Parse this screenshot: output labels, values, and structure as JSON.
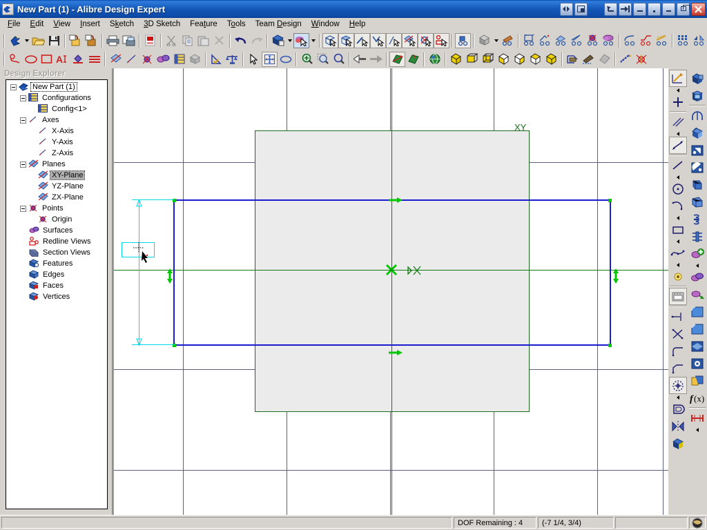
{
  "window": {
    "title": "New Part (1) - Alibre Design Expert",
    "app_icon": "alibre-logo-icon",
    "buttons": [
      {
        "name": "mdi-restore-left-button",
        "glyph": "◀▶"
      },
      {
        "name": "mdi-minimize-left-button",
        "glyph": "▣"
      },
      {
        "name": "undo-window-button",
        "glyph": "↰"
      },
      {
        "name": "pin-window-button",
        "glyph": "⇥"
      },
      {
        "name": "minimize-button",
        "glyph": "–"
      },
      {
        "name": "dot-button",
        "glyph": "·"
      },
      {
        "name": "minimize2-button",
        "glyph": "–"
      },
      {
        "name": "restore-button",
        "glyph": "❐"
      },
      {
        "name": "close-button",
        "glyph": "✕"
      }
    ]
  },
  "menubar": {
    "items": [
      {
        "label": "File",
        "accel": "F"
      },
      {
        "label": "Edit",
        "accel": "E"
      },
      {
        "label": "View",
        "accel": "V"
      },
      {
        "label": "Insert",
        "accel": "I"
      },
      {
        "label": "Sketch",
        "accel": "k"
      },
      {
        "label": "3D Sketch",
        "accel": "3"
      },
      {
        "label": "Feature",
        "accel": "t"
      },
      {
        "label": "Tools",
        "accel": "o"
      },
      {
        "label": "Team Design",
        "accel": "D"
      },
      {
        "label": "Window",
        "accel": "W"
      },
      {
        "label": "Help",
        "accel": "H"
      }
    ]
  },
  "toolbar_main": {
    "groups": [
      [
        "new-part-icon",
        "new-part-dropdown-icon",
        "open-icon",
        "save-icon"
      ],
      [
        "check-out-icon",
        "check-in-icon"
      ],
      [
        "print-icon",
        "print-preview-icon"
      ],
      [
        "export-pdf-icon"
      ],
      [
        "cut-icon",
        "copy-icon",
        "paste-icon",
        "delete-icon"
      ],
      [
        "undo-icon",
        "redo-icon"
      ],
      [
        "view-orientation-icon",
        "view-orientation-dropdown-icon",
        "select-mode-icon",
        "select-mode-dropdown-icon"
      ],
      [
        "select-part-icon",
        "select-face-icon",
        "select-edge-icon",
        "select-vertex-icon",
        "select-point-icon",
        "select-plane-icon",
        "select-axis-icon",
        "select-sketch-icon"
      ],
      [
        "assembly-icon"
      ],
      [
        "render-shaded-icon",
        "render-dropdown-icon",
        "color-properties-icon"
      ],
      [
        "extrude-boss-icon",
        "revolve-boss-icon",
        "sweep-boss-icon",
        "loft-boss-icon",
        "extrude-cut-icon",
        "revolve-cut-icon"
      ],
      [
        "fillet-icon",
        "chamfer-icon",
        "shell-icon"
      ],
      [
        "pattern-icon",
        "mirror-icon",
        "draft-icon"
      ]
    ]
  },
  "toolbar_sketch": {
    "groups": [
      [
        "sketch-arc-icon",
        "sketch-ellipse-icon",
        "sketch-rectangle-icon",
        "sketch-text-icon",
        "sketch-fill-icon",
        "sketch-offset-icon"
      ],
      [
        "plane-icon",
        "axis-icon",
        "point-icon",
        "surface-icon",
        "config-icon",
        "solid-icon"
      ],
      [
        "dimension-icon",
        "constraint-icon"
      ],
      [
        "select-tool-icon",
        "pan-tool-icon",
        "rotate-tool-icon"
      ],
      [
        "zoom-in-icon",
        "zoom-window-icon",
        "zoom-fit-icon"
      ],
      [
        "previous-view-icon",
        "next-view-icon"
      ],
      [
        "activate-sketch-icon",
        "sketch-plane-icon"
      ],
      [
        "global-view-icon"
      ],
      [
        "view-isometric-icon",
        "view-front-icon",
        "view-back-icon",
        "view-left-icon",
        "view-right-icon",
        "view-top-icon",
        "view-bottom-icon"
      ],
      [
        "section-view-icon",
        "redline-icon",
        "shaded-mode-icon"
      ],
      [
        "measure-icon",
        "analyze-icon"
      ]
    ]
  },
  "explorer": {
    "title": "Design Explorer",
    "tree": [
      {
        "depth": 0,
        "label": "New Part (1)",
        "icon": "part-icon",
        "expander": "minus",
        "state": "dashed"
      },
      {
        "depth": 1,
        "label": "Configurations",
        "icon": "configurations-icon",
        "expander": "minus",
        "state": "normal"
      },
      {
        "depth": 2,
        "label": "Config<1>",
        "icon": "config-icon",
        "expander": "none",
        "state": "normal"
      },
      {
        "depth": 1,
        "label": "Axes",
        "icon": "axes-icon",
        "expander": "minus",
        "state": "normal"
      },
      {
        "depth": 2,
        "label": "X-Axis",
        "icon": "axis-icon",
        "expander": "none",
        "state": "normal"
      },
      {
        "depth": 2,
        "label": "Y-Axis",
        "icon": "axis-icon",
        "expander": "none",
        "state": "normal"
      },
      {
        "depth": 2,
        "label": "Z-Axis",
        "icon": "axis-icon",
        "expander": "none",
        "state": "normal"
      },
      {
        "depth": 1,
        "label": "Planes",
        "icon": "planes-icon",
        "expander": "minus",
        "state": "normal"
      },
      {
        "depth": 2,
        "label": "XY-Plane",
        "icon": "plane-icon",
        "expander": "none",
        "state": "selected"
      },
      {
        "depth": 2,
        "label": "YZ-Plane",
        "icon": "plane-icon",
        "expander": "none",
        "state": "normal"
      },
      {
        "depth": 2,
        "label": "ZX-Plane",
        "icon": "plane-icon",
        "expander": "none",
        "state": "normal"
      },
      {
        "depth": 1,
        "label": "Points",
        "icon": "points-icon",
        "expander": "minus",
        "state": "normal"
      },
      {
        "depth": 2,
        "label": "Origin",
        "icon": "origin-icon",
        "expander": "none",
        "state": "normal"
      },
      {
        "depth": 1,
        "label": "Surfaces",
        "icon": "surfaces-icon",
        "expander": "none",
        "state": "normal"
      },
      {
        "depth": 1,
        "label": "Redline Views",
        "icon": "redline-views-icon",
        "expander": "none",
        "state": "normal"
      },
      {
        "depth": 1,
        "label": "Section Views",
        "icon": "section-views-icon",
        "expander": "none",
        "state": "normal"
      },
      {
        "depth": 1,
        "label": "Features",
        "icon": "features-icon",
        "expander": "none",
        "state": "normal"
      },
      {
        "depth": 1,
        "label": "Edges",
        "icon": "edges-icon",
        "expander": "none",
        "state": "normal"
      },
      {
        "depth": 1,
        "label": "Faces",
        "icon": "faces-icon",
        "expander": "none",
        "state": "normal"
      },
      {
        "depth": 1,
        "label": "Vertices",
        "icon": "vertices-icon",
        "expander": "none",
        "state": "normal"
      }
    ]
  },
  "canvas": {
    "plane_label": "XY",
    "colors": {
      "grid": "#5a5f7a",
      "sketch_blue": "#1a1ad0",
      "plane_green": "#0f7a0f",
      "dimension_cyan": "#00d8e8",
      "vertex_green": "#00c800",
      "shaded_fill": "#ebebeb",
      "background": "#ffffff"
    }
  },
  "right_toolbar": {
    "col1": [
      {
        "name": "sketch-mode-icon",
        "state": "framed"
      },
      {
        "name": "flyout-arrow-1",
        "state": "flyout"
      },
      {
        "name": "sketch-point-icon",
        "state": "normal"
      },
      {
        "name": "separator-1",
        "state": "sep"
      },
      {
        "name": "parallel-constraint-icon",
        "state": "normal"
      },
      {
        "name": "flyout-arrow-2",
        "state": "flyout"
      },
      {
        "name": "dimension-tool-icon",
        "state": "framed"
      },
      {
        "name": "separator-2",
        "state": "sep"
      },
      {
        "name": "line-tool-icon",
        "state": "normal"
      },
      {
        "name": "flyout-arrow-3",
        "state": "flyout"
      },
      {
        "name": "circle-tool-icon",
        "state": "normal"
      },
      {
        "name": "arc-tool-icon",
        "state": "normal"
      },
      {
        "name": "flyout-arrow-4",
        "state": "flyout"
      },
      {
        "name": "rectangle-tool-icon",
        "state": "normal"
      },
      {
        "name": "flyout-arrow-5",
        "state": "flyout"
      },
      {
        "name": "spline-tool-icon",
        "state": "normal"
      },
      {
        "name": "flyout-arrow-6",
        "state": "flyout"
      },
      {
        "name": "reference-point-icon",
        "state": "normal"
      },
      {
        "name": "separator-3",
        "state": "sep"
      },
      {
        "name": "sketch-image-icon",
        "state": "normal"
      },
      {
        "name": "separator-4",
        "state": "sep"
      },
      {
        "name": "linear-dimension-icon",
        "state": "normal"
      },
      {
        "name": "intersect-icon",
        "state": "normal"
      },
      {
        "name": "fillet-sketch-icon",
        "state": "normal"
      },
      {
        "name": "chamfer-sketch-icon",
        "state": "normal"
      },
      {
        "name": "sketch-pattern-icon",
        "state": "normal"
      },
      {
        "name": "flyout-arrow-7",
        "state": "flyout"
      },
      {
        "name": "offset-sketch-icon",
        "state": "normal"
      },
      {
        "name": "mirror-sketch-icon",
        "state": "normal"
      },
      {
        "name": "project-sketch-icon",
        "state": "normal"
      }
    ],
    "col2": [
      {
        "name": "extrude-boss-icon",
        "state": "normal"
      },
      {
        "name": "revolve-boss-icon",
        "state": "normal"
      },
      {
        "name": "separator-5",
        "state": "sep"
      },
      {
        "name": "sweep-boss-icon",
        "state": "normal"
      },
      {
        "name": "loft-boss-icon",
        "state": "normal"
      },
      {
        "name": "extrude-cut-icon",
        "state": "normal"
      },
      {
        "name": "revolve-cut-icon",
        "state": "normal"
      },
      {
        "name": "sweep-cut-icon",
        "state": "normal"
      },
      {
        "name": "loft-cut-icon",
        "state": "normal"
      },
      {
        "name": "helical-boss-icon",
        "state": "normal"
      },
      {
        "name": "helical-cut-icon",
        "state": "normal"
      },
      {
        "name": "add-feature-icon",
        "state": "normal"
      },
      {
        "name": "flyout-arrow-8",
        "state": "flyout"
      },
      {
        "name": "surface-feature-icon",
        "state": "normal"
      },
      {
        "name": "surface-offset-icon",
        "state": "normal"
      },
      {
        "name": "fillet-feature-icon",
        "state": "normal"
      },
      {
        "name": "chamfer-feature-icon",
        "state": "normal"
      },
      {
        "name": "shell-feature-icon",
        "state": "normal"
      },
      {
        "name": "draft-feature-icon",
        "state": "normal"
      },
      {
        "name": "pattern-feature-icon",
        "state": "normal"
      },
      {
        "name": "mirror-feature-icon",
        "state": "normal"
      },
      {
        "name": "equation-icon",
        "state": "normal",
        "label": "f(x)"
      },
      {
        "name": "measure-feature-icon",
        "state": "normal"
      },
      {
        "name": "flyout-arrow-9",
        "state": "flyout"
      }
    ]
  },
  "statusbar": {
    "message": "",
    "dof": "DOF Remaining : 4",
    "coordinates": "(-7 1/4,  3/4)",
    "extra": "",
    "globe_icon": "globe-icon"
  }
}
